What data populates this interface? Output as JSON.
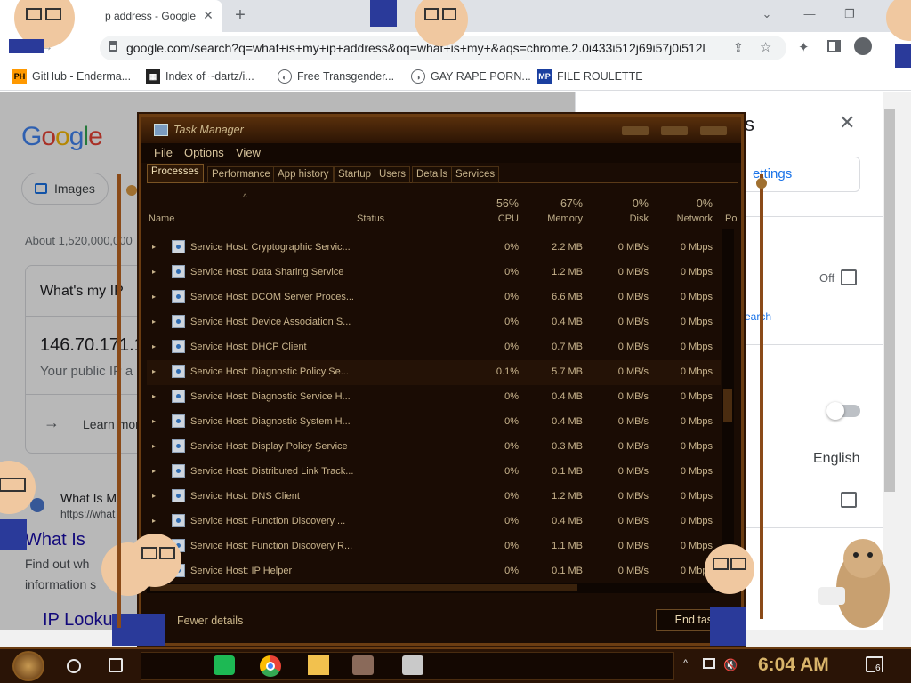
{
  "browser": {
    "tab_title": "p address - Google",
    "url": "google.com/search?q=what+is+my+ip+address&oq=what+is+my+&aqs=chrome.2.0i433i512j69i57j0i512l...",
    "bookmarks": [
      {
        "icon": "PH",
        "label": "GitHub - Enderma..."
      },
      {
        "icon": "dir",
        "label": "Index of ~dartz/i..."
      },
      {
        "icon": "globe",
        "label": "Free Transgender..."
      },
      {
        "icon": "globe",
        "label": "GAY RAPE PORN..."
      },
      {
        "icon": "MP",
        "label": "FILE ROULETTE"
      }
    ]
  },
  "google": {
    "logo": "Google",
    "images_chip": "Images",
    "about": "About 1,520,000,000",
    "card_question": "What's my IP",
    "ip": "146.70.171.1",
    "public_ip": "Your public IP a",
    "learn_more": "Learn mor",
    "result_site": "What Is M",
    "result_url": "https://what",
    "result_title": "What Is",
    "result_snippet_1": "Find out wh",
    "result_snippet_2": "information s",
    "ip_lookup": "IP Looku"
  },
  "quick_settings": {
    "title_partial": "s",
    "see_settings": "ettings",
    "off_label": "Off",
    "search_link": "earch",
    "language": "English"
  },
  "task_manager": {
    "title": "Task Manager",
    "menu": [
      "File",
      "Options",
      "View"
    ],
    "tabs": [
      "Processes",
      "Performance",
      "App history",
      "Startup",
      "Users",
      "Details",
      "Services"
    ],
    "columns": {
      "name": "Name",
      "status": "Status",
      "cpu_pct": "56%",
      "cpu": "CPU",
      "mem_pct": "67%",
      "memory": "Memory",
      "disk_pct": "0%",
      "disk": "Disk",
      "net_pct": "0%",
      "network": "Network",
      "power_partial": "Po"
    },
    "rows": [
      {
        "name": "Service Host: Cryptographic Servic...",
        "cpu": "0%",
        "memory": "2.2 MB",
        "disk": "0 MB/s",
        "network": "0 Mbps"
      },
      {
        "name": "Service Host: Data Sharing Service",
        "cpu": "0%",
        "memory": "1.2 MB",
        "disk": "0 MB/s",
        "network": "0 Mbps"
      },
      {
        "name": "Service Host: DCOM Server Proces...",
        "cpu": "0%",
        "memory": "6.6 MB",
        "disk": "0 MB/s",
        "network": "0 Mbps"
      },
      {
        "name": "Service Host: Device Association S...",
        "cpu": "0%",
        "memory": "0.4 MB",
        "disk": "0 MB/s",
        "network": "0 Mbps"
      },
      {
        "name": "Service Host: DHCP Client",
        "cpu": "0%",
        "memory": "0.7 MB",
        "disk": "0 MB/s",
        "network": "0 Mbps"
      },
      {
        "name": "Service Host: Diagnostic Policy Se...",
        "cpu": "0.1%",
        "memory": "5.7 MB",
        "disk": "0 MB/s",
        "network": "0 Mbps"
      },
      {
        "name": "Service Host: Diagnostic Service H...",
        "cpu": "0%",
        "memory": "0.4 MB",
        "disk": "0 MB/s",
        "network": "0 Mbps"
      },
      {
        "name": "Service Host: Diagnostic System H...",
        "cpu": "0%",
        "memory": "0.4 MB",
        "disk": "0 MB/s",
        "network": "0 Mbps"
      },
      {
        "name": "Service Host: Display Policy Service",
        "cpu": "0%",
        "memory": "0.3 MB",
        "disk": "0 MB/s",
        "network": "0 Mbps"
      },
      {
        "name": "Service Host: Distributed Link Track...",
        "cpu": "0%",
        "memory": "0.1 MB",
        "disk": "0 MB/s",
        "network": "0 Mbps"
      },
      {
        "name": "Service Host: DNS Client",
        "cpu": "0%",
        "memory": "1.2 MB",
        "disk": "0 MB/s",
        "network": "0 Mbps"
      },
      {
        "name": "Service Host: Function Discovery ...",
        "cpu": "0%",
        "memory": "0.4 MB",
        "disk": "0 MB/s",
        "network": "0 Mbps"
      },
      {
        "name": "Service Host: Function Discovery R...",
        "cpu": "0%",
        "memory": "1.1 MB",
        "disk": "0 MB/s",
        "network": "0 Mbps"
      },
      {
        "name": "Service Host: IP Helper",
        "cpu": "0%",
        "memory": "0.1 MB",
        "disk": "0 MB/s",
        "network": "0 Mbps"
      }
    ],
    "fewer_details": "Fewer details",
    "end_task": "End task"
  },
  "taskbar": {
    "clock": "6:04 AM",
    "notification_count": "6"
  },
  "colors": {
    "steampunk_brown": "#2a1406",
    "copper": "#6b3d12",
    "clock_gold": "#d8b46a",
    "google_blue": "#4285f4"
  }
}
